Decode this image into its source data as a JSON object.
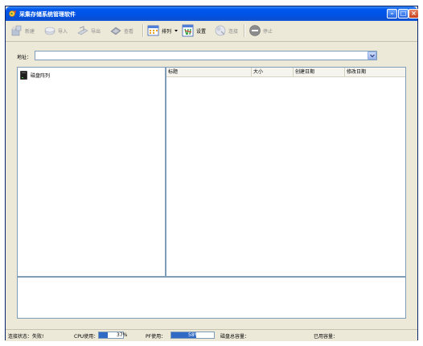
{
  "window": {
    "title": "采集存储系统管理软件",
    "minimize_glyph": "–",
    "maximize_glyph": "□",
    "close_glyph": "×"
  },
  "toolbar": {
    "items": [
      {
        "label": "新建",
        "icon": "new-icon",
        "enabled": false
      },
      {
        "label": "导入",
        "icon": "import-icon",
        "enabled": false
      },
      {
        "label": "导出",
        "icon": "export-icon",
        "enabled": false
      },
      {
        "label": "查看",
        "icon": "view-icon",
        "enabled": false
      },
      {
        "label": "排列",
        "icon": "arrange-icon",
        "enabled": true,
        "has_dropdown": true
      },
      {
        "label": "设置",
        "icon": "settings-icon",
        "enabled": true
      },
      {
        "label": "连接",
        "icon": "connect-icon",
        "enabled": false
      },
      {
        "label": "停止",
        "icon": "stop-icon",
        "enabled": false
      }
    ]
  },
  "address": {
    "label": "地址：",
    "value": ""
  },
  "tree": {
    "items": [
      {
        "label": "磁盘阵列",
        "icon": "disk-array-icon"
      }
    ]
  },
  "list": {
    "columns": [
      "标题",
      "大小",
      "创建日期",
      "修改日期"
    ],
    "rows": []
  },
  "status": {
    "connection_label": "连接状态：失败!",
    "cpu_label": "CPU使用：",
    "cpu_percent": 37,
    "cpu_value": "37%",
    "pf_label": "PF使用：",
    "pf_percent": 58,
    "pf_value": "58%",
    "disk_total_label": "磁盘总容量：",
    "disk_total_value": "",
    "used_label": "已用容量：",
    "used_value": ""
  },
  "colors": {
    "titlebar": "#0058ee",
    "meter_fill": "#316ac5",
    "panel_border": "#7f9db9",
    "window_bg": "#ece9d8"
  }
}
